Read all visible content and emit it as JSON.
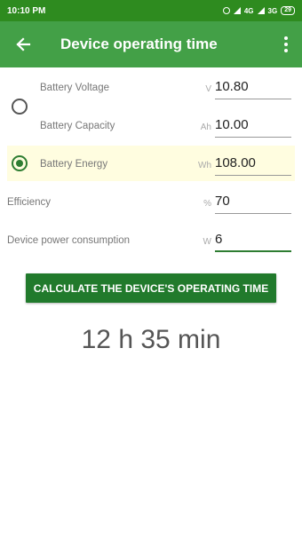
{
  "status_bar": {
    "time": "10:10 PM",
    "network1": "4G",
    "network2": "3G",
    "battery": "29"
  },
  "app_bar": {
    "title": "Device operating time",
    "back_icon": "arrow-left-icon",
    "menu_icon": "more-vert-icon"
  },
  "battery": {
    "voltage": {
      "label": "Battery Voltage",
      "unit": "V",
      "value": "10.80"
    },
    "capacity": {
      "label": "Battery Capacity",
      "unit": "Ah",
      "value": "10.00"
    },
    "energy": {
      "label": "Battery Energy",
      "unit": "Wh",
      "value": "108.00"
    },
    "selected": "energy"
  },
  "efficiency": {
    "label": "Efficiency",
    "unit": "%",
    "value": "70"
  },
  "consumption": {
    "label": "Device power consumption",
    "unit": "W",
    "value": "6"
  },
  "calculate_button": "CALCULATE THE DEVICE'S OPERATING TIME",
  "result": "12 h 35 min",
  "colors": {
    "primary": "#43a047",
    "primary_dark": "#2e8b1f",
    "button": "#217a2c",
    "highlight": "#fffde0"
  }
}
